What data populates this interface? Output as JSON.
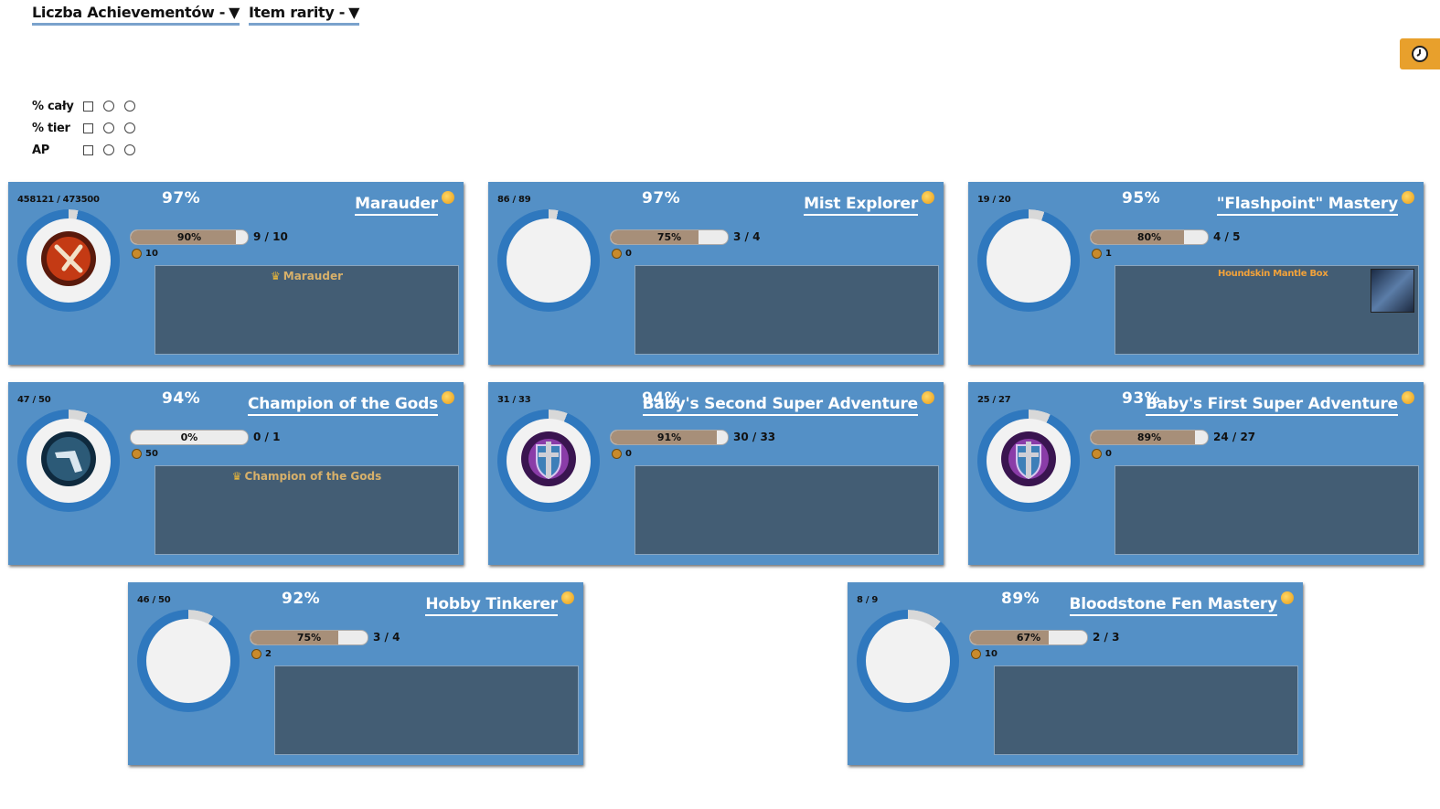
{
  "header": {
    "dropdown_achievements": "Liczba Achievementów -",
    "dropdown_rarity": "Item rarity -",
    "arrow": "▼"
  },
  "filters": [
    {
      "label": "% cały"
    },
    {
      "label": "% tier"
    },
    {
      "label": "AP"
    }
  ],
  "cards": [
    {
      "counts": "458121 / 473500",
      "pct": "97%",
      "title": "Marauder",
      "bar_pct": 90,
      "bar_label": "90%",
      "tiers": "9 / 10",
      "ap": "10",
      "reward_title": "Marauder",
      "reward_item": "",
      "icon": "marauder-icon",
      "ring_gap": 3
    },
    {
      "counts": "86 / 89",
      "pct": "97%",
      "title": "Mist Explorer",
      "bar_pct": 75,
      "bar_label": "75%",
      "tiers": "3 / 4",
      "ap": "0",
      "reward_title": "",
      "reward_item": "",
      "icon": "",
      "ring_gap": 3
    },
    {
      "counts": "19 / 20",
      "pct": "95%",
      "title": "\"Flashpoint\" Mastery",
      "bar_pct": 80,
      "bar_label": "80%",
      "tiers": "4 / 5",
      "ap": "1",
      "reward_title": "",
      "reward_item": "Houndskin Mantle Box",
      "icon": "",
      "ring_gap": 5
    },
    {
      "counts": "47 / 50",
      "pct": "94%",
      "title": "Champion of the Gods",
      "bar_pct": 0,
      "bar_label": "0%",
      "tiers": "0 / 1",
      "ap": "50",
      "reward_title": "Champion of the Gods",
      "reward_item": "",
      "icon": "champion-icon",
      "ring_gap": 6
    },
    {
      "counts": "31 / 33",
      "pct": "94%",
      "title": "Baby's Second Super Adventure",
      "bar_pct": 91,
      "bar_label": "91%",
      "tiers": "30 / 33",
      "ap": "0",
      "reward_title": "",
      "reward_item": "",
      "icon": "shield-icon",
      "ring_gap": 6
    },
    {
      "counts": "25 / 27",
      "pct": "93%",
      "title": "Baby's First Super Adventure",
      "bar_pct": 89,
      "bar_label": "89%",
      "tiers": "24 / 27",
      "ap": "0",
      "reward_title": "",
      "reward_item": "",
      "icon": "shield-icon",
      "ring_gap": 7
    },
    {
      "counts": "46 / 50",
      "pct": "92%",
      "title": "Hobby Tinkerer",
      "bar_pct": 75,
      "bar_label": "75%",
      "tiers": "3 / 4",
      "ap": "2",
      "reward_title": "",
      "reward_item": "",
      "icon": "",
      "ring_gap": 8
    },
    {
      "counts": "8 / 9",
      "pct": "89%",
      "title": "Bloodstone Fen Mastery",
      "bar_pct": 67,
      "bar_label": "67%",
      "tiers": "2 / 3",
      "ap": "10",
      "reward_title": "",
      "reward_item": "",
      "icon": "",
      "ring_gap": 11
    }
  ]
}
